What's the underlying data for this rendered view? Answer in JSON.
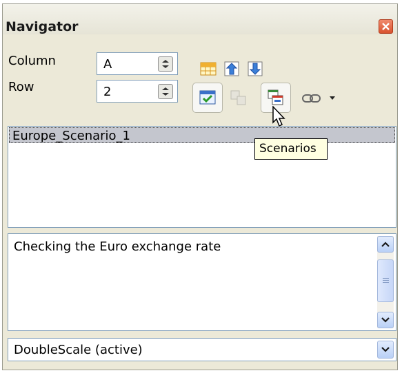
{
  "window": {
    "title": "Navigator",
    "close_icon": "close-icon",
    "close_color": "#d9532f"
  },
  "fields": {
    "column_label": "Column",
    "column_value": "A",
    "row_label": "Row",
    "row_value": "2"
  },
  "toolbar": {
    "icons": [
      "contents-icon",
      "header-icon",
      "footer-icon",
      "drag-mode-icon",
      "promote-icon",
      "scenarios-icon",
      "link-icon",
      "dropdown-arrow-icon"
    ],
    "tooltip": "Scenarios"
  },
  "scenarios_list": {
    "items": [
      "Europe_Scenario_1"
    ],
    "selected_color": "#c4c6ce"
  },
  "description": {
    "text": "Checking the Euro exchange rate"
  },
  "document_select": {
    "value": "DoubleScale (active)"
  }
}
